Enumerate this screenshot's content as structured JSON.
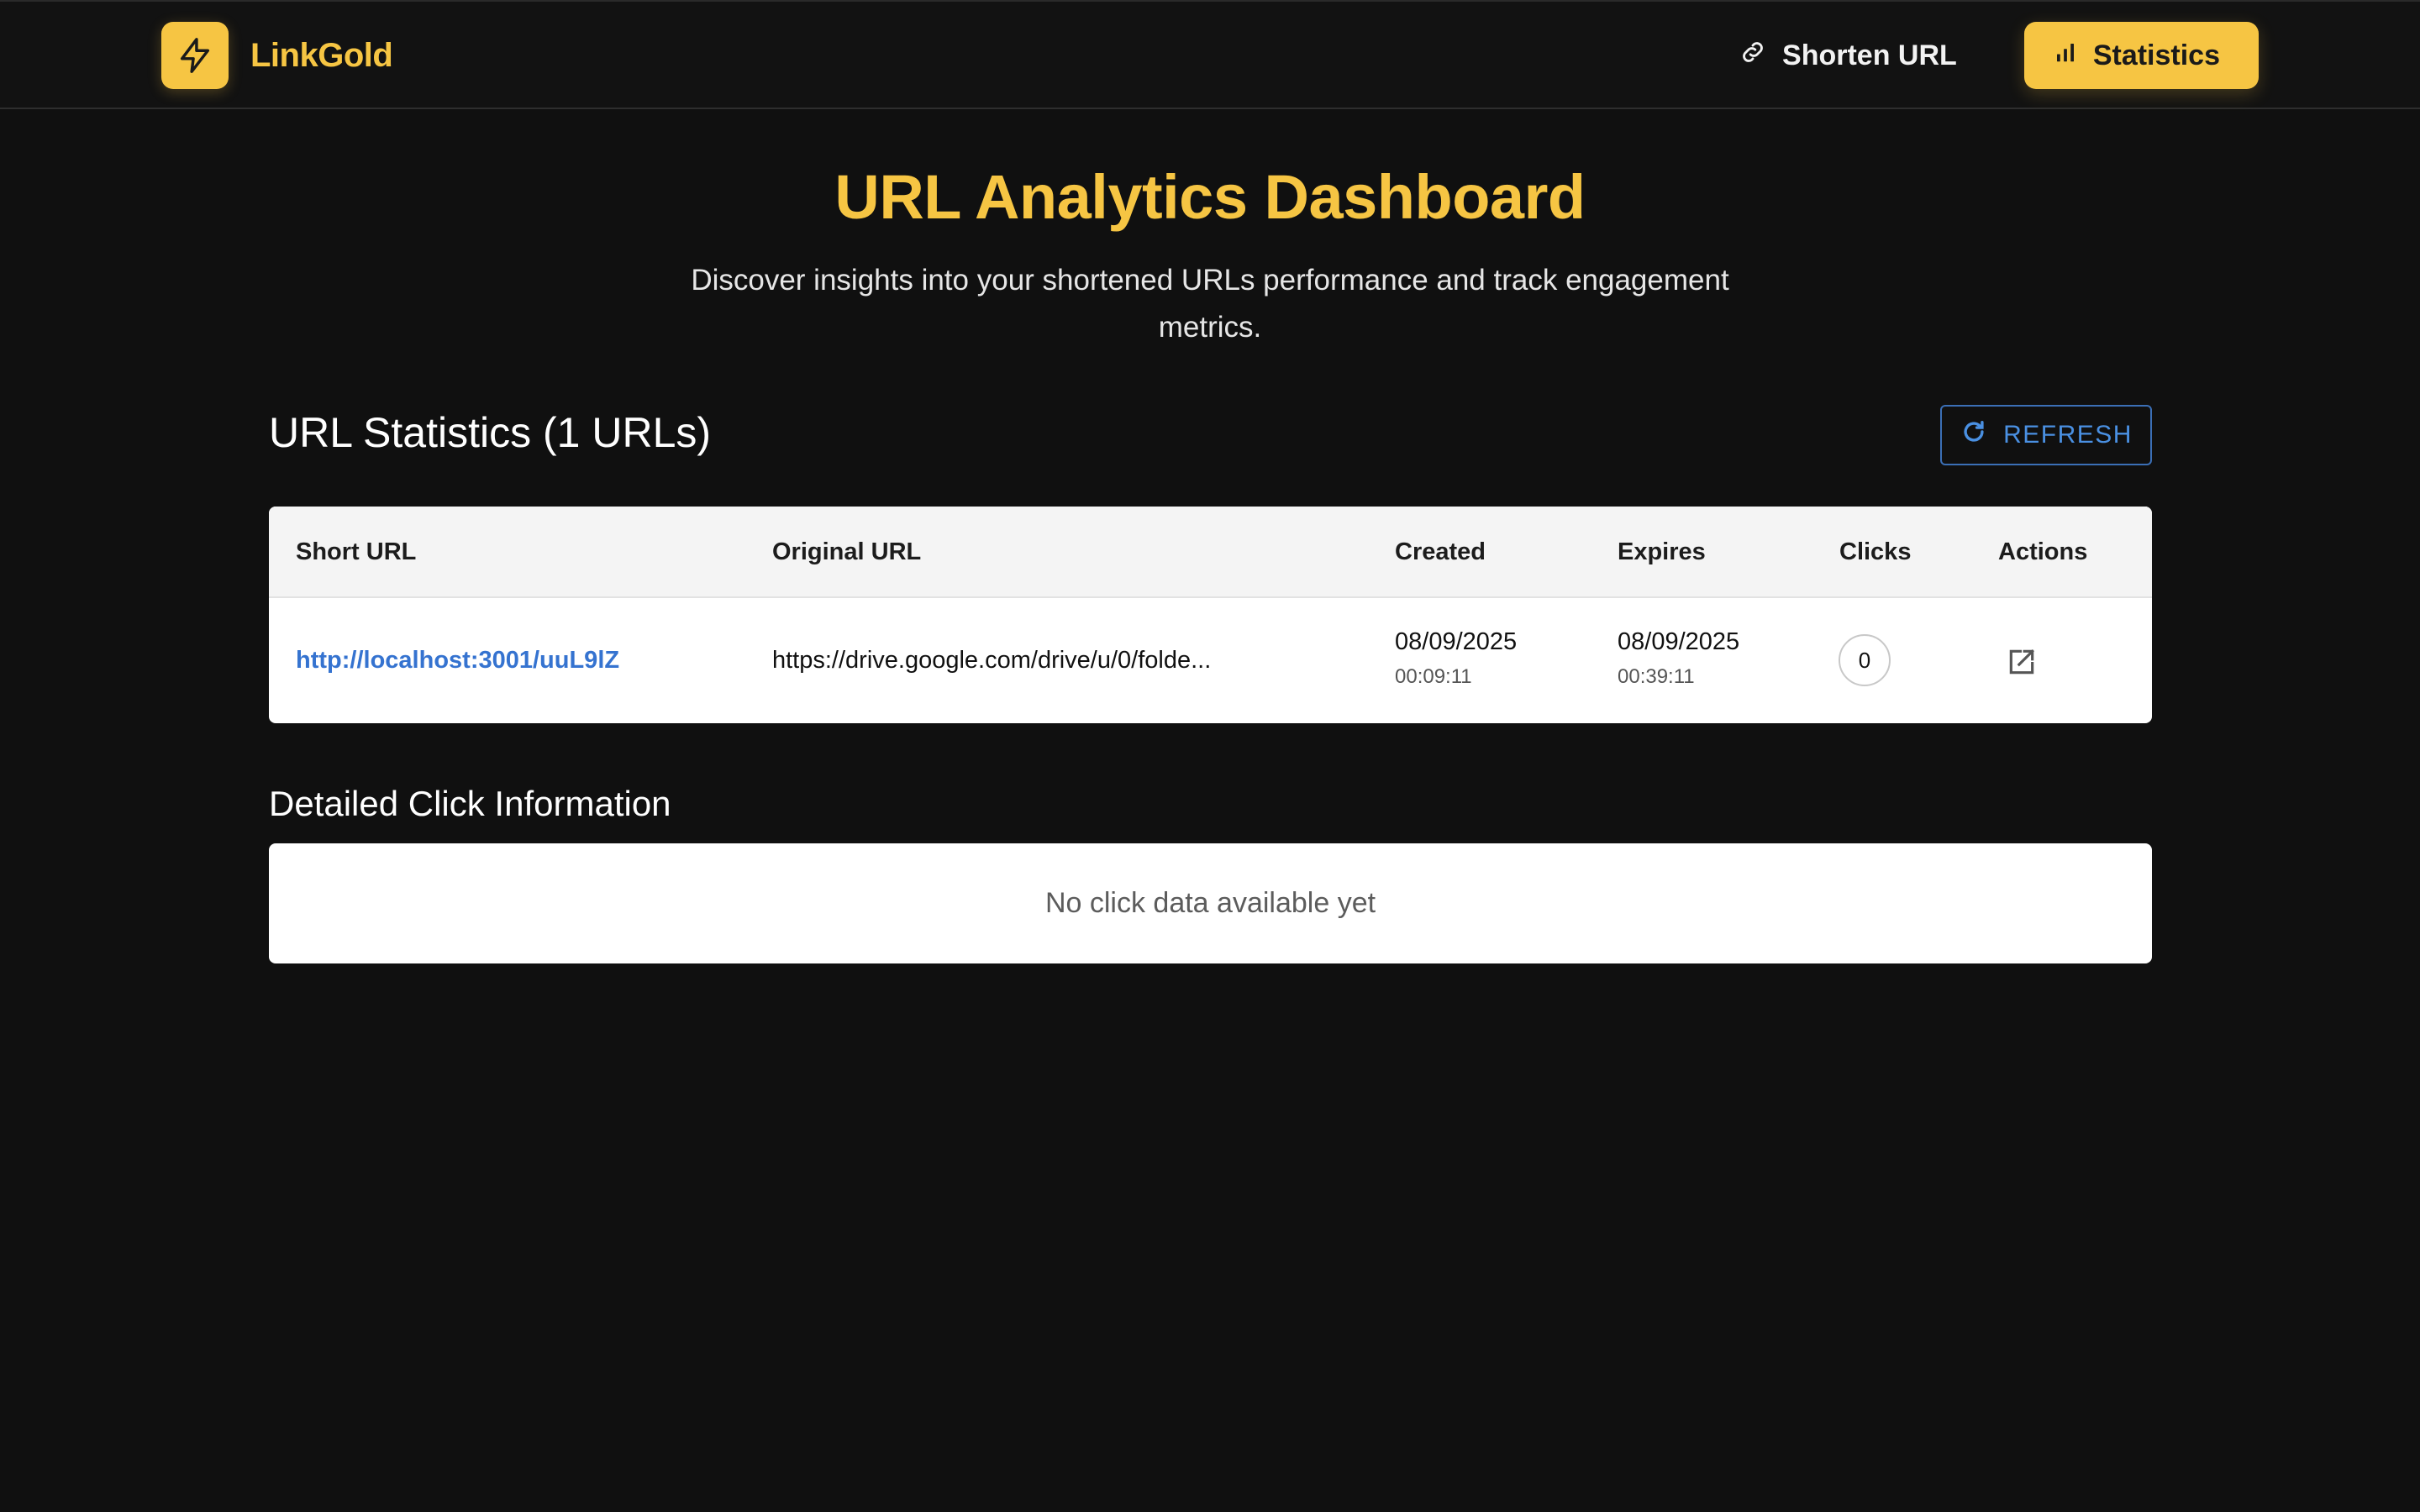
{
  "app": {
    "brand_name": "LinkGold",
    "brand_icon": "lightning-bolt-icon",
    "accent_color": "#f6c543",
    "background_color": "#101010"
  },
  "nav": {
    "items": [
      {
        "label": "Shorten URL",
        "icon": "link-icon",
        "active": false
      },
      {
        "label": "Statistics",
        "icon": "bar-chart-icon",
        "active": true
      }
    ]
  },
  "hero": {
    "title": "URL Analytics Dashboard",
    "subtitle": "Discover insights into your shortened URLs performance and track engagement metrics."
  },
  "stats": {
    "title": "URL Statistics (1 URLs)",
    "refresh_label": "REFRESH",
    "refresh_icon": "refresh-icon",
    "columns": [
      "Short URL",
      "Original URL",
      "Created",
      "Expires",
      "Clicks",
      "Actions"
    ],
    "rows": [
      {
        "short_url": "http://localhost:3001/uuL9lZ",
        "original_url": "https://drive.google.com/drive/u/0/folde...",
        "created_date": "08/09/2025",
        "created_time": "00:09:11",
        "expires_date": "08/09/2025",
        "expires_time": "00:39:11",
        "clicks": "0",
        "action_icon": "open-in-new-icon"
      }
    ]
  },
  "clicks": {
    "title": "Detailed Click Information",
    "empty_message": "No click data available yet"
  }
}
